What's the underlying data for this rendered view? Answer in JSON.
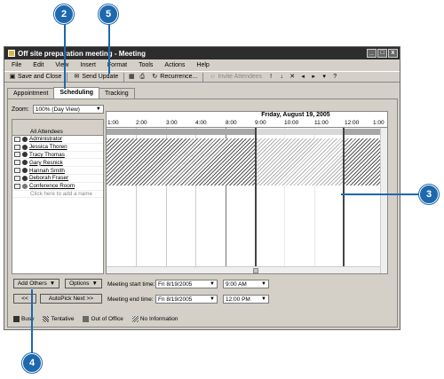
{
  "callouts": {
    "c2": "2",
    "c5": "5",
    "c3": "3",
    "c4": "4"
  },
  "window": {
    "title": "Off site preparation meeting - Meeting",
    "buttons": [
      "_",
      "□",
      "x"
    ]
  },
  "menu": [
    "File",
    "Edit",
    "View",
    "Insert",
    "Format",
    "Tools",
    "Actions",
    "Help"
  ],
  "toolbar": {
    "save_close": "Save and Close",
    "send_update": "Send Update",
    "recurrence": "Recurrence...",
    "invite": "Invite Attendees"
  },
  "tabs": [
    "Appointment",
    "Scheduling",
    "Tracking"
  ],
  "zoom": {
    "label": "Zoom:",
    "value": "100% (Day View)"
  },
  "schedule": {
    "date": "Friday, August 19, 2005",
    "times": [
      "1:00",
      "2:00",
      "3:00",
      "4:00",
      "8:00",
      "9:00",
      "10:00",
      "11:00",
      "12:00",
      "1:00"
    ]
  },
  "attendees": {
    "header": "All Attendees",
    "list": [
      "Administrator",
      "Jessica Thoren",
      "Tracy Thomas",
      "Gary Resnick",
      "Hannah Smith",
      "Deborah Fraser",
      "Conference Room"
    ],
    "add_placeholder": "Click here to add a name"
  },
  "buttons": {
    "add_others": "Add Others",
    "options": "Options",
    "prev": "<<",
    "autopick": "AutoPick Next >>"
  },
  "meeting": {
    "start_label": "Meeting start time:",
    "start_date": "Fri 8/19/2005",
    "start_time": "9:00 AM",
    "end_label": "Meeting end time:",
    "end_date": "Fri 8/19/2005",
    "end_time": "12:00 PM"
  },
  "legend": [
    "Busy",
    "Tentative",
    "Out of Office",
    "No Information"
  ]
}
